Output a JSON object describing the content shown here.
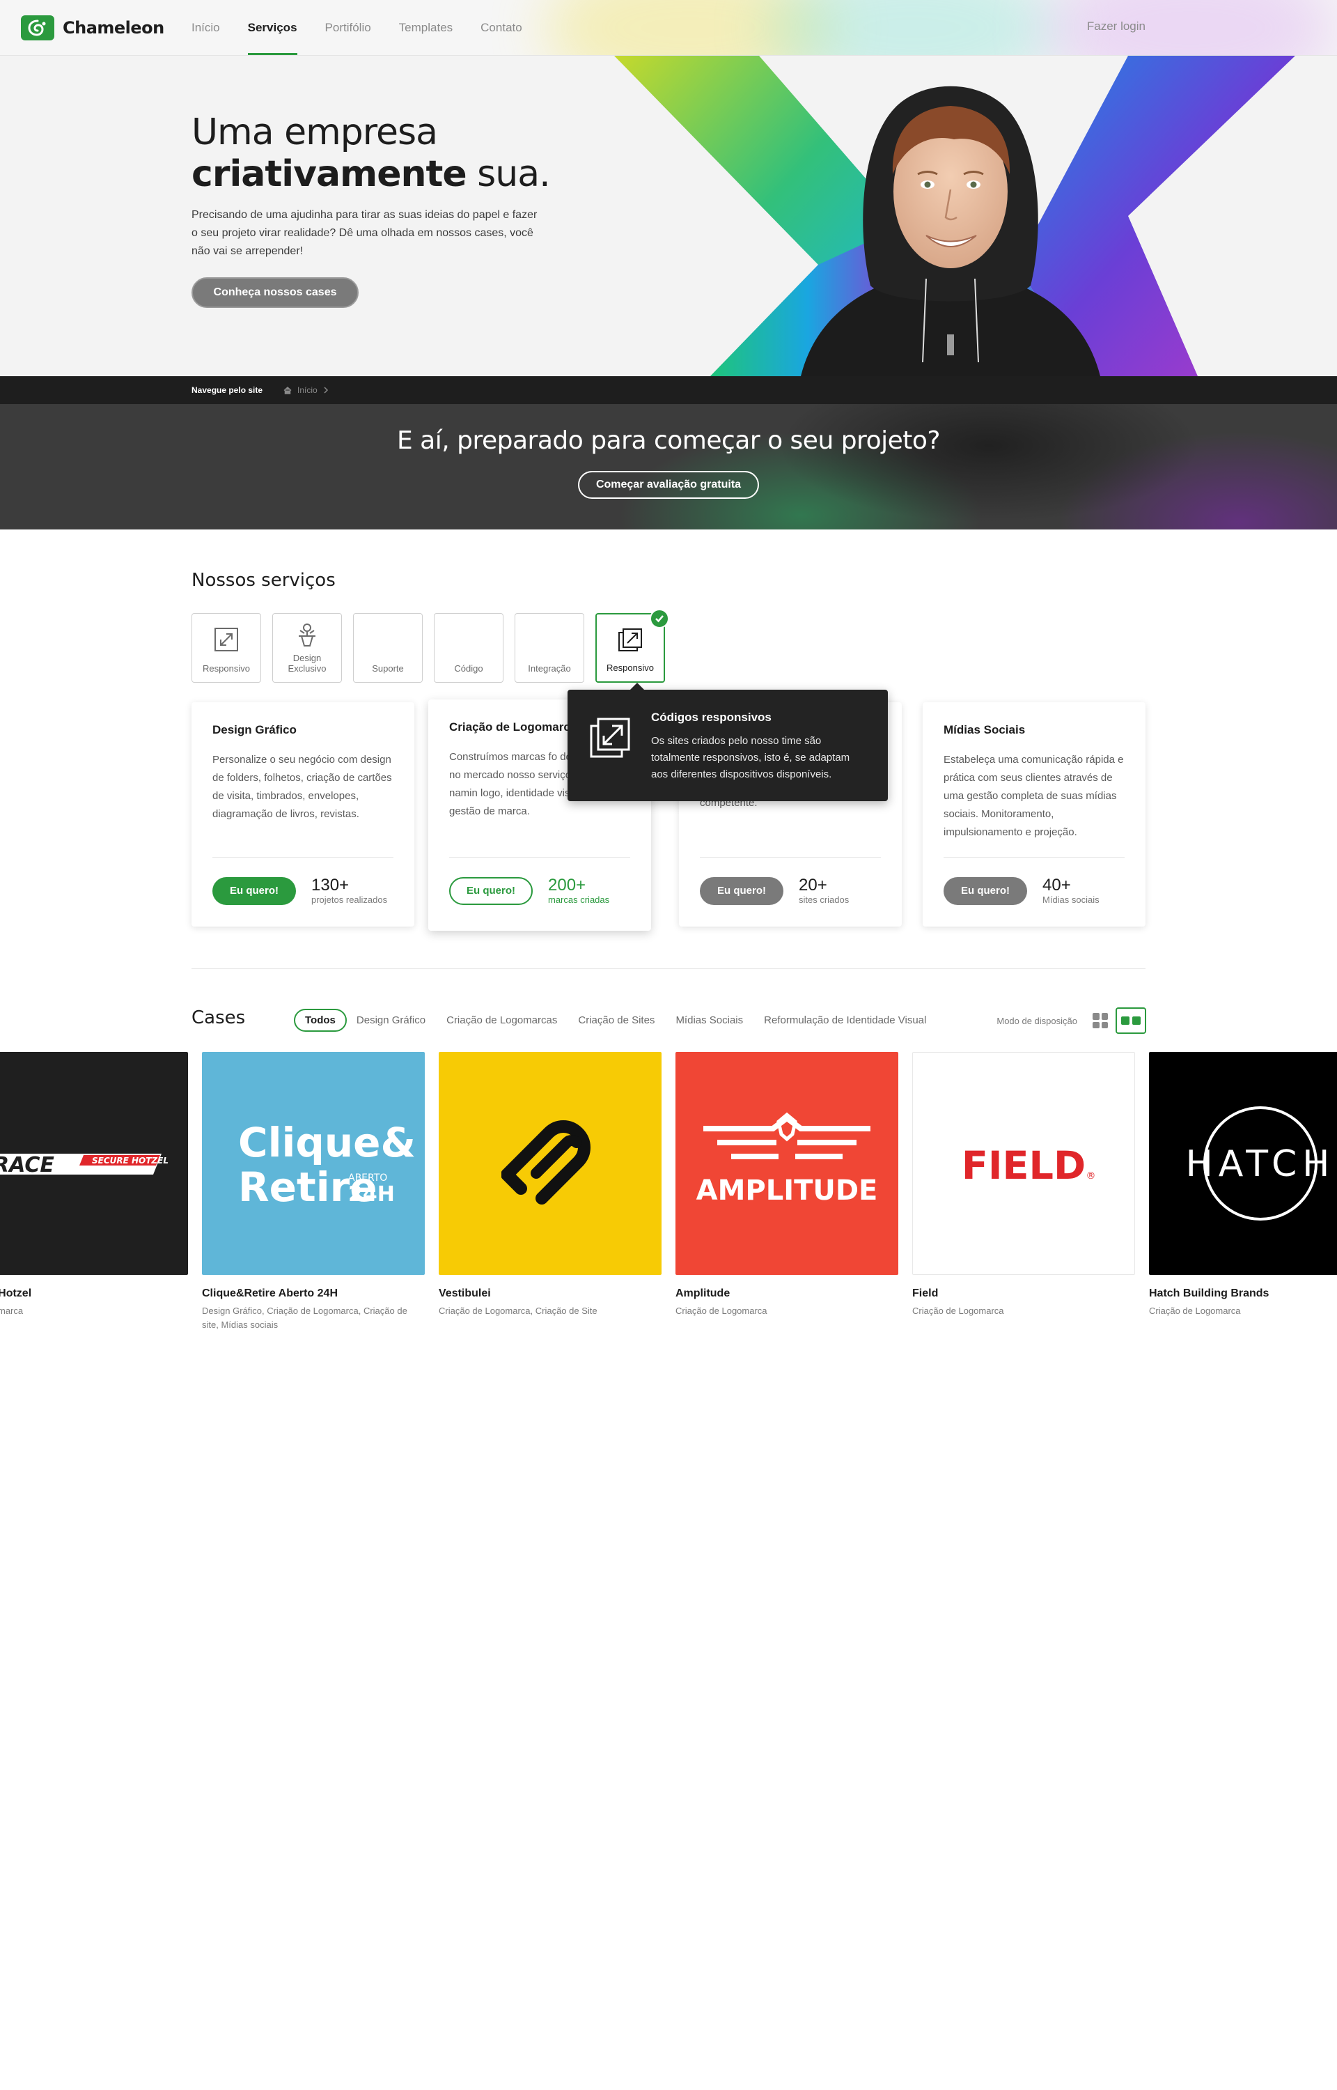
{
  "nav": {
    "brand": "Chameleon",
    "links": [
      "Início",
      "Serviços",
      "Portifólio",
      "Templates",
      "Contato"
    ],
    "active_index": 1,
    "login": "Fazer login"
  },
  "hero": {
    "title_line1": "Uma empresa",
    "title_bold": "criativamente",
    "title_rest": " sua.",
    "description": "Precisando de uma ajudinha para tirar as suas ideias do papel e fazer o seu projeto virar realidade? Dê uma olhada em nossos cases, você não vai se arrepender!",
    "button": "Conheça nossos cases"
  },
  "breadcrumb": {
    "title": "Navegue pelo site",
    "items": [
      "Início"
    ]
  },
  "cta": {
    "title": "E aí, preparado para começar o seu projeto?",
    "button": "Começar avaliação gratuita"
  },
  "services": {
    "title": "Nossos serviços",
    "tabs": [
      {
        "label": "Responsivo",
        "icon": "responsive-icon"
      },
      {
        "label": "Design Exclusivo",
        "icon": "design-icon"
      },
      {
        "label": "Suporte",
        "icon": ""
      },
      {
        "label": "Código",
        "icon": ""
      },
      {
        "label": "Integração",
        "icon": ""
      },
      {
        "label": "Responsivo",
        "icon": "responsive-icon"
      }
    ],
    "active_tab": 5,
    "tooltip": {
      "title": "Códigos responsivos",
      "text": "Os sites criados pelo nosso time são totalmente responsivos, isto é, se adaptam aos diferentes dispositivos disponíveis."
    },
    "cards": [
      {
        "title": "Design Gráfico",
        "text": "Personalize o seu negócio com design de folders, folhetos, criação de cartões de visita, timbrados, envelopes, diagramação de livros, revistas.",
        "button": "Eu quero!",
        "button_style": "green",
        "stat": "130+",
        "stat_label": "projetos realizados",
        "stat_green": false
      },
      {
        "title": "Criação de Logomarca",
        "text": "Construímos marcas fo desejadas no mercado nosso serviço de namin logo, identidade visual e gestão de marca.",
        "button": "Eu quero!",
        "button_style": "outline",
        "stat": "200+",
        "stat_label": "marcas criadas",
        "stat_green": true
      },
      {
        "title": "",
        "text": "planejamento adequado e uma equipe competente.",
        "button": "Eu quero!",
        "button_style": "gray",
        "stat": "20+",
        "stat_label": "sites criados",
        "stat_green": false
      },
      {
        "title": "Mídias Sociais",
        "text": "Estabeleça uma comunicação rápida e prática com seus clientes através de uma gestão completa de suas mídias sociais. Monitoramento, impulsionamento e projeção.",
        "button": "Eu quero!",
        "button_style": "gray",
        "stat": "40+",
        "stat_label": "Mídias sociais",
        "stat_green": false
      }
    ]
  },
  "cases": {
    "title": "Cases",
    "filters": [
      "Todos",
      "Design Gráfico",
      "Criação de Logomarcas",
      "Criação de Sites",
      "Mídias Sociais",
      "Reformulação de Identidade Visual"
    ],
    "active_filter": 0,
    "mode_label": "Modo de disposição",
    "items": [
      {
        "name": "ecure Hotzel",
        "category": "de Logomarca",
        "logo_text": "RACE",
        "logo_sub": "SECURE HOTZEL",
        "bg": "#1f1f1f"
      },
      {
        "name": "Clique&Retire Aberto 24H",
        "category": "Design Gráfico, Criação de Logomarca, Criação de site, Mídias sociais",
        "logo_text": "Clique&",
        "logo_text2": "Retire",
        "logo_sub": "ABERTO",
        "logo_sub2": "24H",
        "bg": "#5fb6d8"
      },
      {
        "name": "Vestibulei",
        "category": "Criação de Logomarca, Criação de Site",
        "bg": "#f7cb05"
      },
      {
        "name": "Amplitude",
        "category": "Criação de Logomarca",
        "logo_text": "AMPLITUDE",
        "bg": "#f04635"
      },
      {
        "name": "Field",
        "category": "Criação de Logomarca",
        "logo_text": "FIELD",
        "bg": "#ffffff"
      },
      {
        "name": "Hatch Building Brands",
        "category": "Criação de Logomarca",
        "logo_text": "HATCH",
        "bg": "#000000"
      }
    ]
  },
  "colors": {
    "accent": "#2b9a3e",
    "dark": "#1e1e1e",
    "cta_bg": "#3c3c3c"
  }
}
